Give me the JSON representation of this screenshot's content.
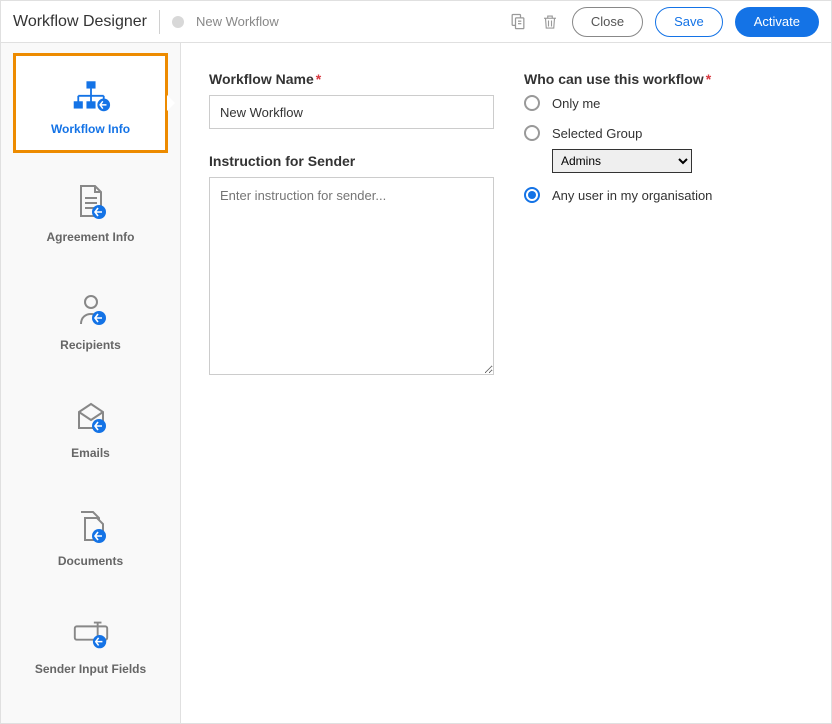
{
  "header": {
    "title": "Workflow Designer",
    "subtitle": "New Workflow",
    "buttons": {
      "close": "Close",
      "save": "Save",
      "activate": "Activate"
    }
  },
  "sidebar": {
    "items": [
      {
        "label": "Workflow Info"
      },
      {
        "label": "Agreement Info"
      },
      {
        "label": "Recipients"
      },
      {
        "label": "Emails"
      },
      {
        "label": "Documents"
      },
      {
        "label": "Sender Input Fields"
      }
    ]
  },
  "form": {
    "workflowName": {
      "label": "Workflow Name",
      "value": "New Workflow"
    },
    "instruction": {
      "label": "Instruction for Sender",
      "placeholder": "Enter instruction for sender..."
    },
    "access": {
      "label": "Who can use this workflow",
      "options": {
        "onlyMe": "Only me",
        "selectedGroup": "Selected Group",
        "anyUser": "Any user in my organisation"
      },
      "groupSelect": {
        "value": "Admins",
        "options": [
          "Admins"
        ]
      }
    }
  }
}
